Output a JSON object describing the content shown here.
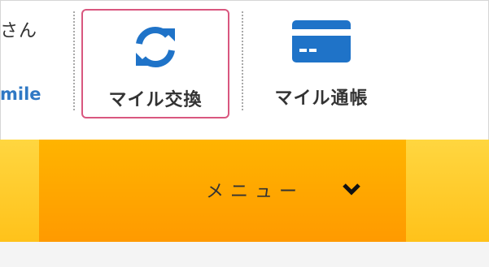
{
  "header": {
    "greeting_fragment": "さん",
    "link_fragment": "mile",
    "nav_items": [
      {
        "label": "マイル交換",
        "icon": "refresh-icon",
        "highlighted": true,
        "icon_color": "#1f73c8"
      },
      {
        "label": "マイル通帳",
        "icon": "credit-card-icon",
        "highlighted": false,
        "icon_color": "#1f73c8"
      }
    ],
    "highlight_border_color": "#d9577f"
  },
  "menu_bar": {
    "label": "メニュー",
    "icon": "chevron-down-icon",
    "background_color": "#ffa800"
  }
}
